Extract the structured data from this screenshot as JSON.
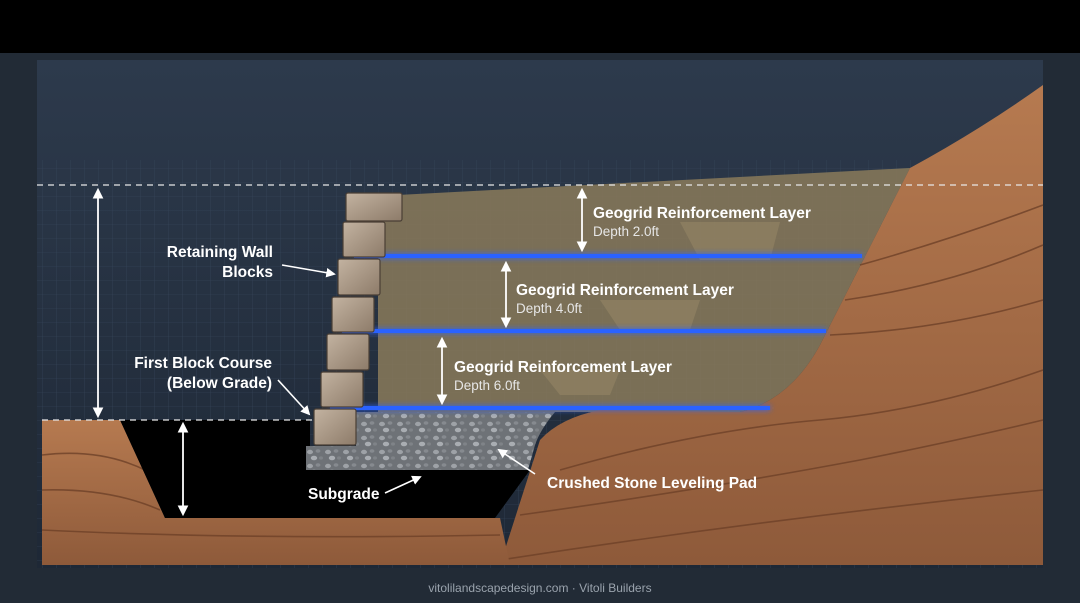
{
  "diagram": {
    "labels": {
      "retaining_wall_blocks_line1": "Retaining Wall",
      "retaining_wall_blocks_line2": "Blocks",
      "first_block_course_line1": "First Block Course",
      "first_block_course_line2": "(Below Grade)",
      "subgrade": "Subgrade",
      "crushed_stone_leveling_pad": "Crushed Stone Leveling Pad"
    },
    "geogrid_layers": [
      {
        "title": "Geogrid Reinforcement Layer",
        "depth": "Depth 2.0ft"
      },
      {
        "title": "Geogrid Reinforcement Layer",
        "depth": "Depth 4.0ft"
      },
      {
        "title": "Geogrid Reinforcement Layer",
        "depth": "Depth 6.0ft"
      }
    ],
    "footer": "vitolilandscapedesign.com · Vitoli Builders"
  },
  "colors": {
    "page_background": "#222b36",
    "header_bar": "#000000",
    "soil": "#a66a45",
    "backfill": "#8a7a5a",
    "geogrid": "#2c62ff",
    "subgrade": "#000000",
    "gravel": "#8c8f93"
  }
}
